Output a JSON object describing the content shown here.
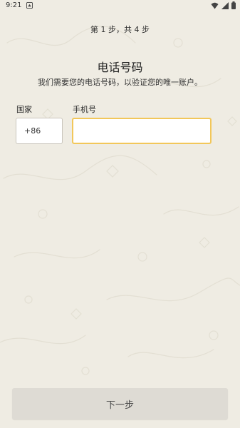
{
  "status_bar": {
    "time": "9:21"
  },
  "header": {
    "step_text": "第 1 步，共 4 步"
  },
  "main": {
    "title": "电话号码",
    "subtitle": "我们需要您的电话号码，以验证您的唯一账户。",
    "country_label": "国家",
    "country_code": "+86",
    "phone_label": "手机号",
    "phone_value": "",
    "phone_placeholder": ""
  },
  "footer": {
    "next_button_label": "下一步"
  },
  "colors": {
    "background": "#efece3",
    "input_focus_border": "#f2c75a",
    "button_background": "#dedbd4"
  },
  "icons": {
    "status_app": "notification-app-icon",
    "wifi": "wifi-icon",
    "signal": "signal-icon",
    "battery": "battery-icon"
  }
}
